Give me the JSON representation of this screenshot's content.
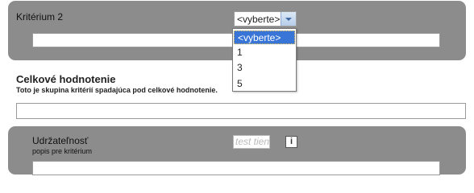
{
  "criterion2": {
    "title": "Kritérium 2",
    "select_value": "<vyberte>",
    "options": [
      "<vyberte>",
      "1",
      "3",
      "5"
    ]
  },
  "overall": {
    "heading": "Celkové hodnotenie",
    "subheading": "Toto je skupina kritérií spadajúca pod celkové hodnotenie."
  },
  "sustainability": {
    "title": "Udržateľnosť",
    "description": "popis pre kritérium",
    "input_placeholder": "test tien",
    "info_label": "i"
  }
}
